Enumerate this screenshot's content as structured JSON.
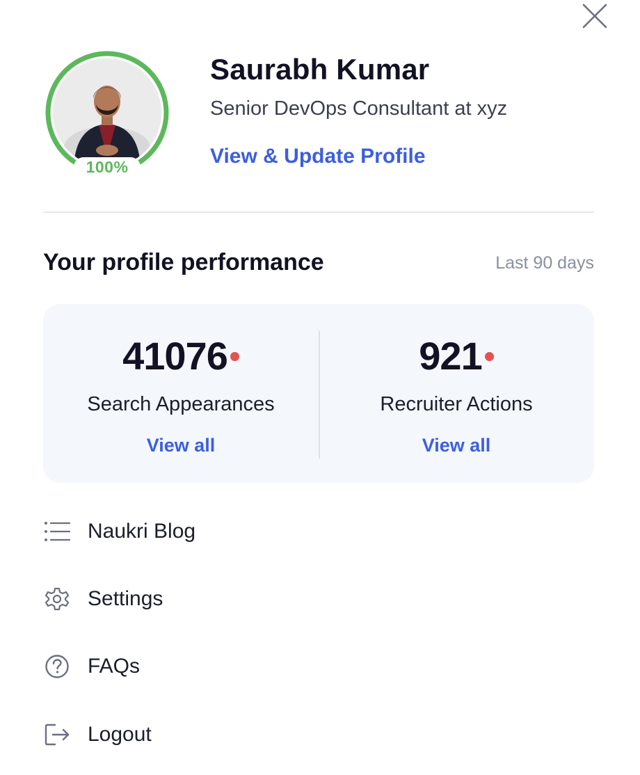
{
  "close": {
    "icon": "close-icon"
  },
  "profile": {
    "name": "Saurabh Kumar",
    "designation": "Senior DevOps Consultant at xyz",
    "link_label": "View & Update Profile",
    "completion": "100%",
    "completion_value": 1.0,
    "ring_color": "#5cb85c"
  },
  "performance": {
    "title": "Your profile performance",
    "range": "Last 90 days",
    "stats": [
      {
        "value": "41076",
        "label": "Search Appearances",
        "link": "View all",
        "has_new": true
      },
      {
        "value": "921",
        "label": "Recruiter Actions",
        "link": "View all",
        "has_new": true
      }
    ]
  },
  "menu": [
    {
      "label": "Naukri Blog",
      "icon": "list-icon"
    },
    {
      "label": "Settings",
      "icon": "gear-icon"
    },
    {
      "label": "FAQs",
      "icon": "question-circle-icon"
    },
    {
      "label": "Logout",
      "icon": "logout-icon"
    }
  ],
  "colors": {
    "accent": "#3b5fe0",
    "new_dot": "#e45252",
    "card_bg": "#f4f7fc"
  }
}
